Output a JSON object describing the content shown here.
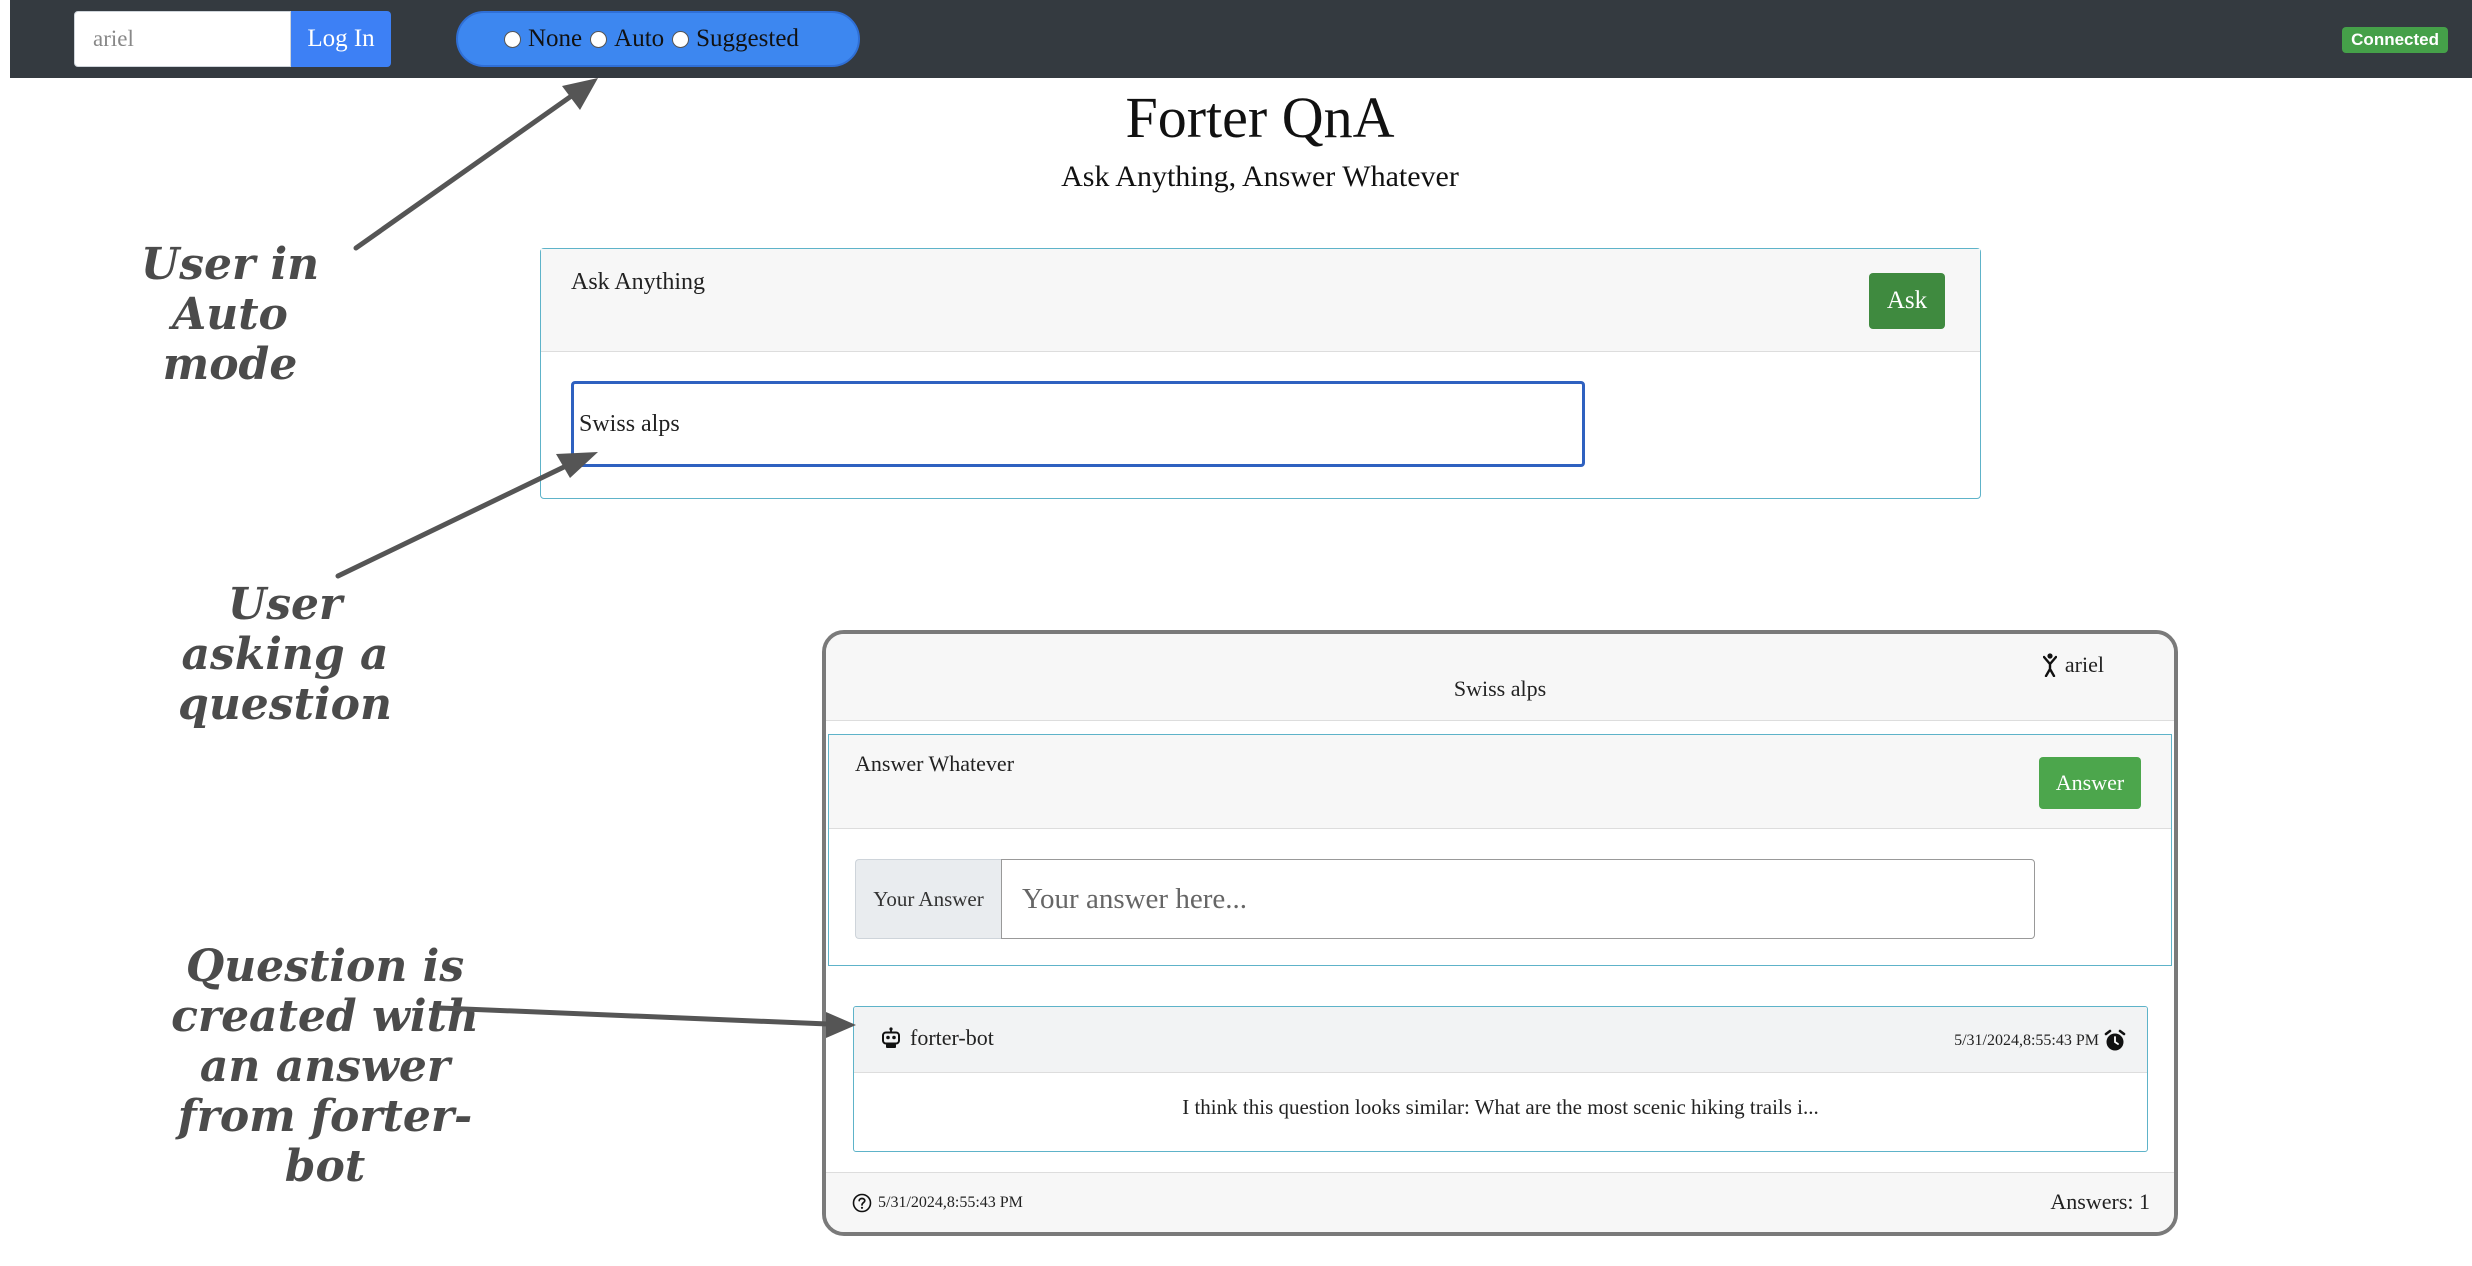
{
  "navbar": {
    "username_value": "ariel",
    "login_label": "Log In",
    "modes": [
      {
        "label": "None",
        "selected": false
      },
      {
        "label": "Auto",
        "selected": false
      },
      {
        "label": "Suggested",
        "selected": false
      }
    ],
    "status_badge": "Connected",
    "status_color": "#45a049"
  },
  "header": {
    "title": "Forter QnA",
    "subtitle": "Ask Anything, Answer Whatever"
  },
  "ask": {
    "label": "Ask Anything",
    "button_label": "Ask",
    "input_value": "Swiss alps"
  },
  "question": {
    "author": "ariel",
    "title": "Swiss alps",
    "answer_section": {
      "label": "Answer Whatever",
      "button_label": "Answer",
      "prepend_label": "Your Answer",
      "placeholder": "Your answer here..."
    },
    "answers": [
      {
        "author": "forter-bot",
        "timestamp": "5/31/2024,8:55:43 PM",
        "text": "I think this question looks similar: What are the most scenic hiking trails i..."
      }
    ],
    "created": "5/31/2024,8:55:43 PM",
    "answer_count": "Answers: 1"
  },
  "annotations": {
    "auto_mode": "User in Auto mode",
    "asking": "User asking a question",
    "created": "Question is created with an answer from forter-bot"
  },
  "icons": [
    "person-icon",
    "robot-icon",
    "alarm-clock-icon",
    "question-circle-icon"
  ]
}
